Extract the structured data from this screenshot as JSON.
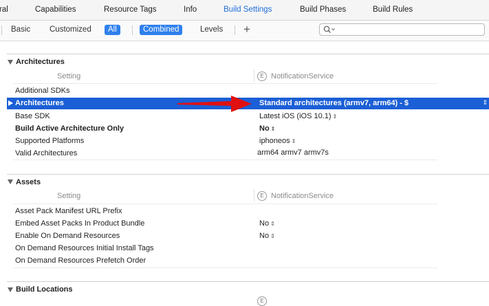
{
  "tabs": [
    {
      "label": "ral",
      "active": false
    },
    {
      "label": "Capabilities",
      "active": false
    },
    {
      "label": "Resource Tags",
      "active": false
    },
    {
      "label": "Info",
      "active": false
    },
    {
      "label": "Build Settings",
      "active": true
    },
    {
      "label": "Build Phases",
      "active": false
    },
    {
      "label": "Build Rules",
      "active": false
    }
  ],
  "filter": {
    "basic": "Basic",
    "customized": "Customized",
    "all": "All",
    "combined": "Combined",
    "levels": "Levels",
    "add": "+",
    "search_icon": "magnifier-icon",
    "search_value": ""
  },
  "columns": {
    "setting": "Setting",
    "target_icon": "E",
    "target": "NotificationService"
  },
  "sections": {
    "architectures": {
      "title": "Architectures",
      "rows": [
        {
          "name": "Additional SDKs",
          "value": ""
        },
        {
          "name": "Architectures",
          "value": "Standard architectures (armv7, arm64)  -  $",
          "selected": true
        },
        {
          "name": "Base SDK",
          "value": "Latest iOS (iOS 10.1)"
        },
        {
          "name": "Build Active Architecture Only",
          "value": "No"
        },
        {
          "name": "Supported Platforms",
          "value": "iphoneos"
        },
        {
          "name": "Valid Architectures",
          "value": "arm64 armv7 armv7s"
        }
      ]
    },
    "assets": {
      "title": "Assets",
      "rows": [
        {
          "name": "Asset Pack Manifest URL Prefix",
          "value": ""
        },
        {
          "name": "Embed Asset Packs In Product Bundle",
          "value": "No"
        },
        {
          "name": "Enable On Demand Resources",
          "value": "No"
        },
        {
          "name": "On Demand Resources Initial Install Tags",
          "value": ""
        },
        {
          "name": "On Demand Resources Prefetch Order",
          "value": ""
        }
      ]
    },
    "build_locations": {
      "title": "Build Locations"
    }
  },
  "colors": {
    "accent": "#2f80ed",
    "selection": "#1b5fd6",
    "arrow": "#e01010"
  }
}
